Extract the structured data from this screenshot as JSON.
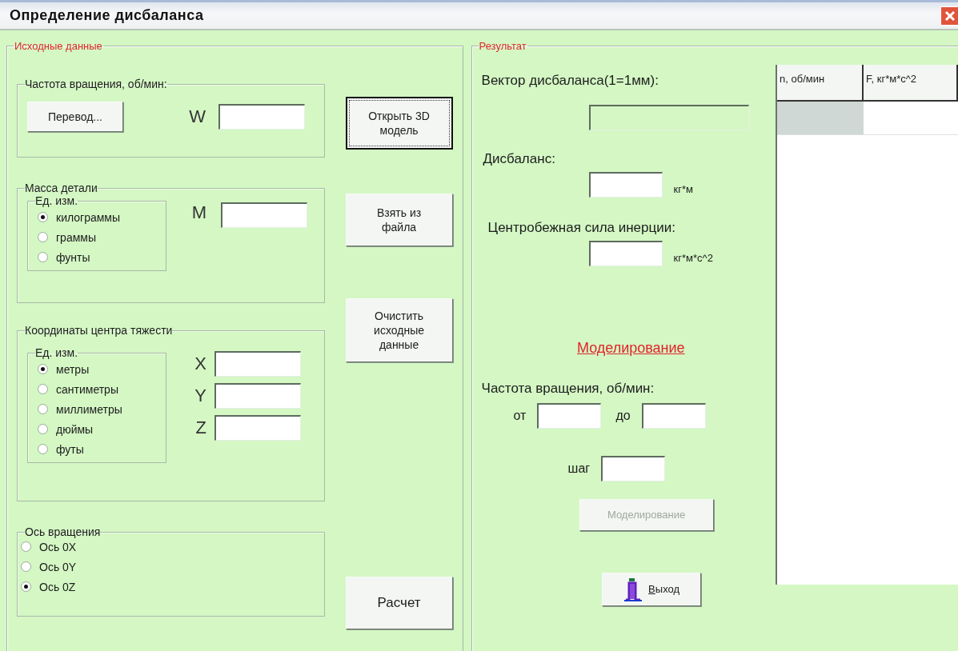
{
  "window": {
    "title": "Определение дисбаланса"
  },
  "input_panel": {
    "legend": "Исходные данные",
    "rotation_speed": {
      "legend": "Частота вращения, об/мин:",
      "convert_button": "Перевод...",
      "field_label": "W"
    },
    "mass": {
      "legend": "Масса детали",
      "units": {
        "legend": "Ед. изм.",
        "options": [
          {
            "label": "килограммы",
            "selected": true
          },
          {
            "label": "граммы",
            "selected": false
          },
          {
            "label": "фунты",
            "selected": false
          }
        ]
      },
      "field_label": "M"
    },
    "center_of_gravity": {
      "legend": "Координаты центра тяжести",
      "units": {
        "legend": "Ед. изм.",
        "options": [
          {
            "label": "метры",
            "selected": true
          },
          {
            "label": "сантиметры",
            "selected": false
          },
          {
            "label": "миллиметры",
            "selected": false
          },
          {
            "label": "дюймы",
            "selected": false
          },
          {
            "label": "футы",
            "selected": false
          }
        ]
      },
      "fields": [
        {
          "label": "X"
        },
        {
          "label": "Y"
        },
        {
          "label": "Z"
        }
      ]
    },
    "rotation_axis": {
      "legend": "Ось вращения",
      "options": [
        {
          "label": "Ось 0X",
          "selected": false
        },
        {
          "label": "Ось 0Y",
          "selected": false
        },
        {
          "label": "Ось 0Z",
          "selected": true
        }
      ]
    },
    "buttons": [
      {
        "label": "Открыть 3D модель",
        "focused": true
      },
      {
        "label": "Взять из файла",
        "focused": false
      },
      {
        "label": "Очистить исходные данные",
        "focused": false
      }
    ],
    "calc_button": "Расчет"
  },
  "result_panel": {
    "legend": "Результат",
    "vector": {
      "label": "Вектор дисбаланса(1=1мм):"
    },
    "imbalance": {
      "label": "Дисбаланс:",
      "unit": "кг*м"
    },
    "force": {
      "label": "Центробежная сила инерции:",
      "unit": "кг*м*с^2"
    },
    "simulation": {
      "heading": "Моделирование",
      "speed_label": "Частота вращения, об/мин:",
      "from_label": "от",
      "to_label": "до",
      "step_label": "шаг",
      "button": {
        "label": "Моделирование",
        "disabled": true
      }
    },
    "exit_button": {
      "mnemonic": "В",
      "label_rest": "ыход"
    },
    "table": {
      "columns": [
        "n, об/мин",
        "F, кг*м*с^2"
      ]
    }
  }
}
